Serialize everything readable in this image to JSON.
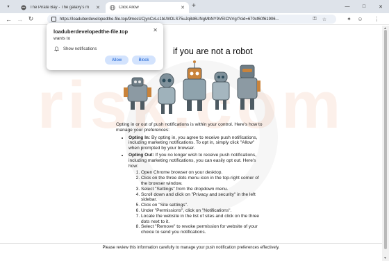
{
  "tabs": [
    {
      "title": "The Pirate Bay - The galaxy's m",
      "active": false
    },
    {
      "title": "Click Allow",
      "active": true
    }
  ],
  "address_bar": {
    "url": "https://loaduberdevelopedthe-file.top/9mosUCjynCvLc1bLWOLS75uJq8d6UNgMbNY9VEICNVg/?cid=670cf60f61906..."
  },
  "popup": {
    "site": "loaduberdevelopedthe-file.top",
    "wants_to": "wants to",
    "permission": "Show notifications",
    "allow_label": "Allow",
    "block_label": "Block"
  },
  "page": {
    "headline": "if you are not   a robot",
    "intro": "Opting in or out of push notifications is within your control. Here's how to manage your preferences:",
    "opt_in_label": "Opting In:",
    "opt_in_text": " By opting in, you agree to receive push notifications, including marketing notifications. To opt in, simply click \"Allow\" when prompted by your browser.",
    "opt_out_label": "Opting Out:",
    "opt_out_text": " If you no longer wish to receive push notifications, including marketing notifications, you can easily opt out. Here's how:",
    "steps": [
      "Open Chrome browser on your desktop.",
      "Click on the three dots menu icon in the top-right corner of the browser window.",
      "Select \"Settings\" from the dropdown menu.",
      "Scroll down and click on \"Privacy and security\" in the left sidebar.",
      "Click on \"Site settings\".",
      "Under \"Permissions\", click on \"Notifications\".",
      "Locate the website in the list of sites and click on the three dots next to it.",
      "Select \"Remove\" to revoke permission for website of your choice to send you notifications."
    ],
    "footer": "Please review this information carefully to manage your push notification preferences effectively."
  },
  "watermark": "risk.com",
  "colors": {
    "tabstrip": "#dee3ea",
    "omnibox": "#edf1f7",
    "button_bg": "#d3e3fd",
    "button_text": "#0b57d0"
  }
}
